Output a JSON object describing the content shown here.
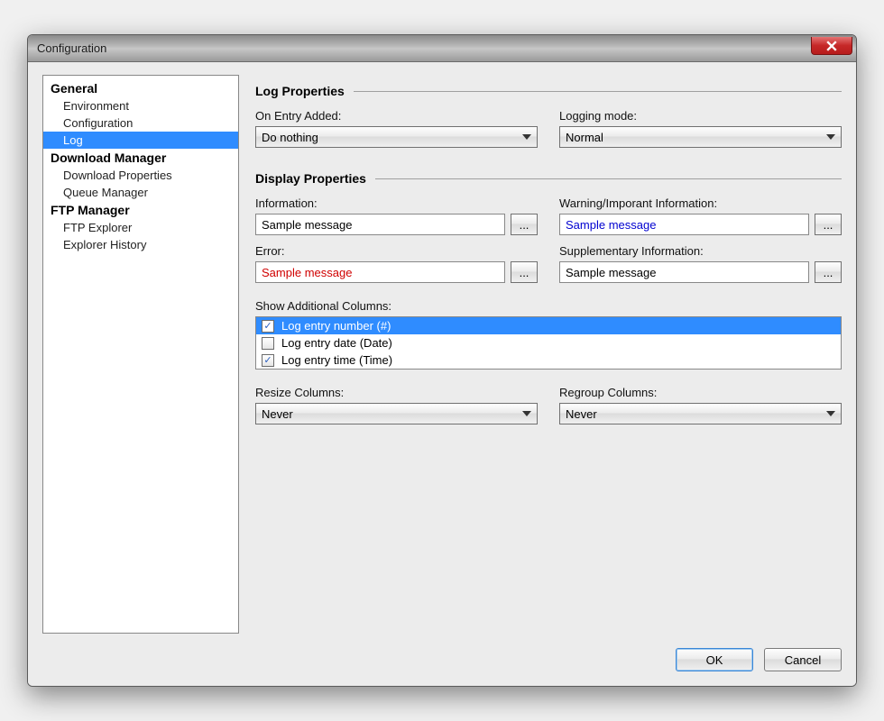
{
  "window": {
    "title": "Configuration"
  },
  "sidebar": {
    "groups": [
      {
        "label": "General",
        "items": [
          {
            "label": "Environment",
            "selected": false
          },
          {
            "label": "Configuration",
            "selected": false
          },
          {
            "label": "Log",
            "selected": true
          }
        ]
      },
      {
        "label": "Download Manager",
        "items": [
          {
            "label": "Download Properties",
            "selected": false
          },
          {
            "label": "Queue Manager",
            "selected": false
          }
        ]
      },
      {
        "label": "FTP Manager",
        "items": [
          {
            "label": "FTP Explorer",
            "selected": false
          },
          {
            "label": "Explorer History",
            "selected": false
          }
        ]
      }
    ]
  },
  "log_properties": {
    "header": "Log Properties",
    "on_entry_added": {
      "label": "On Entry Added:",
      "value": "Do nothing"
    },
    "logging_mode": {
      "label": "Logging mode:",
      "value": "Normal"
    }
  },
  "display_properties": {
    "header": "Display Properties",
    "information": {
      "label": "Information:",
      "value": "Sample message",
      "browse": "..."
    },
    "warning": {
      "label": "Warning/Imporant Information:",
      "value": "Sample message",
      "browse": "..."
    },
    "error": {
      "label": "Error:",
      "value": "Sample message",
      "browse": "..."
    },
    "supplementary": {
      "label": "Supplementary Information:",
      "value": "Sample message",
      "browse": "..."
    },
    "show_additional_columns": {
      "label": "Show Additional Columns:",
      "items": [
        {
          "label": "Log entry number (#)",
          "checked": true,
          "selected": true
        },
        {
          "label": "Log entry date (Date)",
          "checked": false,
          "selected": false
        },
        {
          "label": "Log entry time (Time)",
          "checked": true,
          "selected": false
        }
      ]
    },
    "resize_columns": {
      "label": "Resize Columns:",
      "value": "Never"
    },
    "regroup_columns": {
      "label": "Regroup Columns:",
      "value": "Never"
    }
  },
  "buttons": {
    "ok": "OK",
    "cancel": "Cancel"
  },
  "checkmark": "✓"
}
